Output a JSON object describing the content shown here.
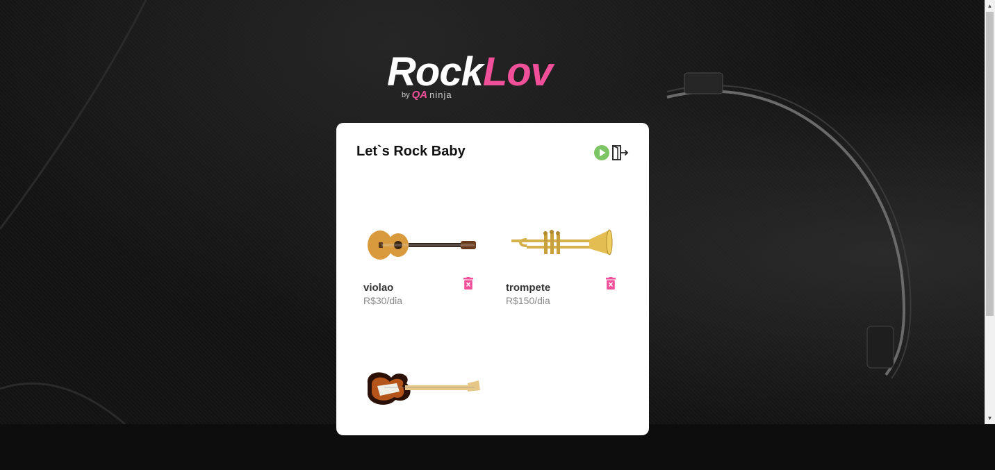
{
  "brand": {
    "rock": "Rock",
    "lov": "Lov",
    "by": "by",
    "qa": "QA",
    "ninja": "ninja"
  },
  "card": {
    "title": "Let`s Rock Baby"
  },
  "icons": {
    "play": "play-circle-icon",
    "logout": "logout-icon",
    "delete": "trash-icon"
  },
  "items": [
    {
      "name": "violao",
      "price": "R$30/dia",
      "image": "acoustic-guitar"
    },
    {
      "name": "trompete",
      "price": "R$150/dia",
      "image": "trumpet"
    },
    {
      "name": "",
      "price": "",
      "image": "electric-guitar"
    }
  ],
  "colors": {
    "accent": "#f0509a",
    "play": "#7cc464",
    "background": "#111111",
    "card": "#ffffff"
  }
}
